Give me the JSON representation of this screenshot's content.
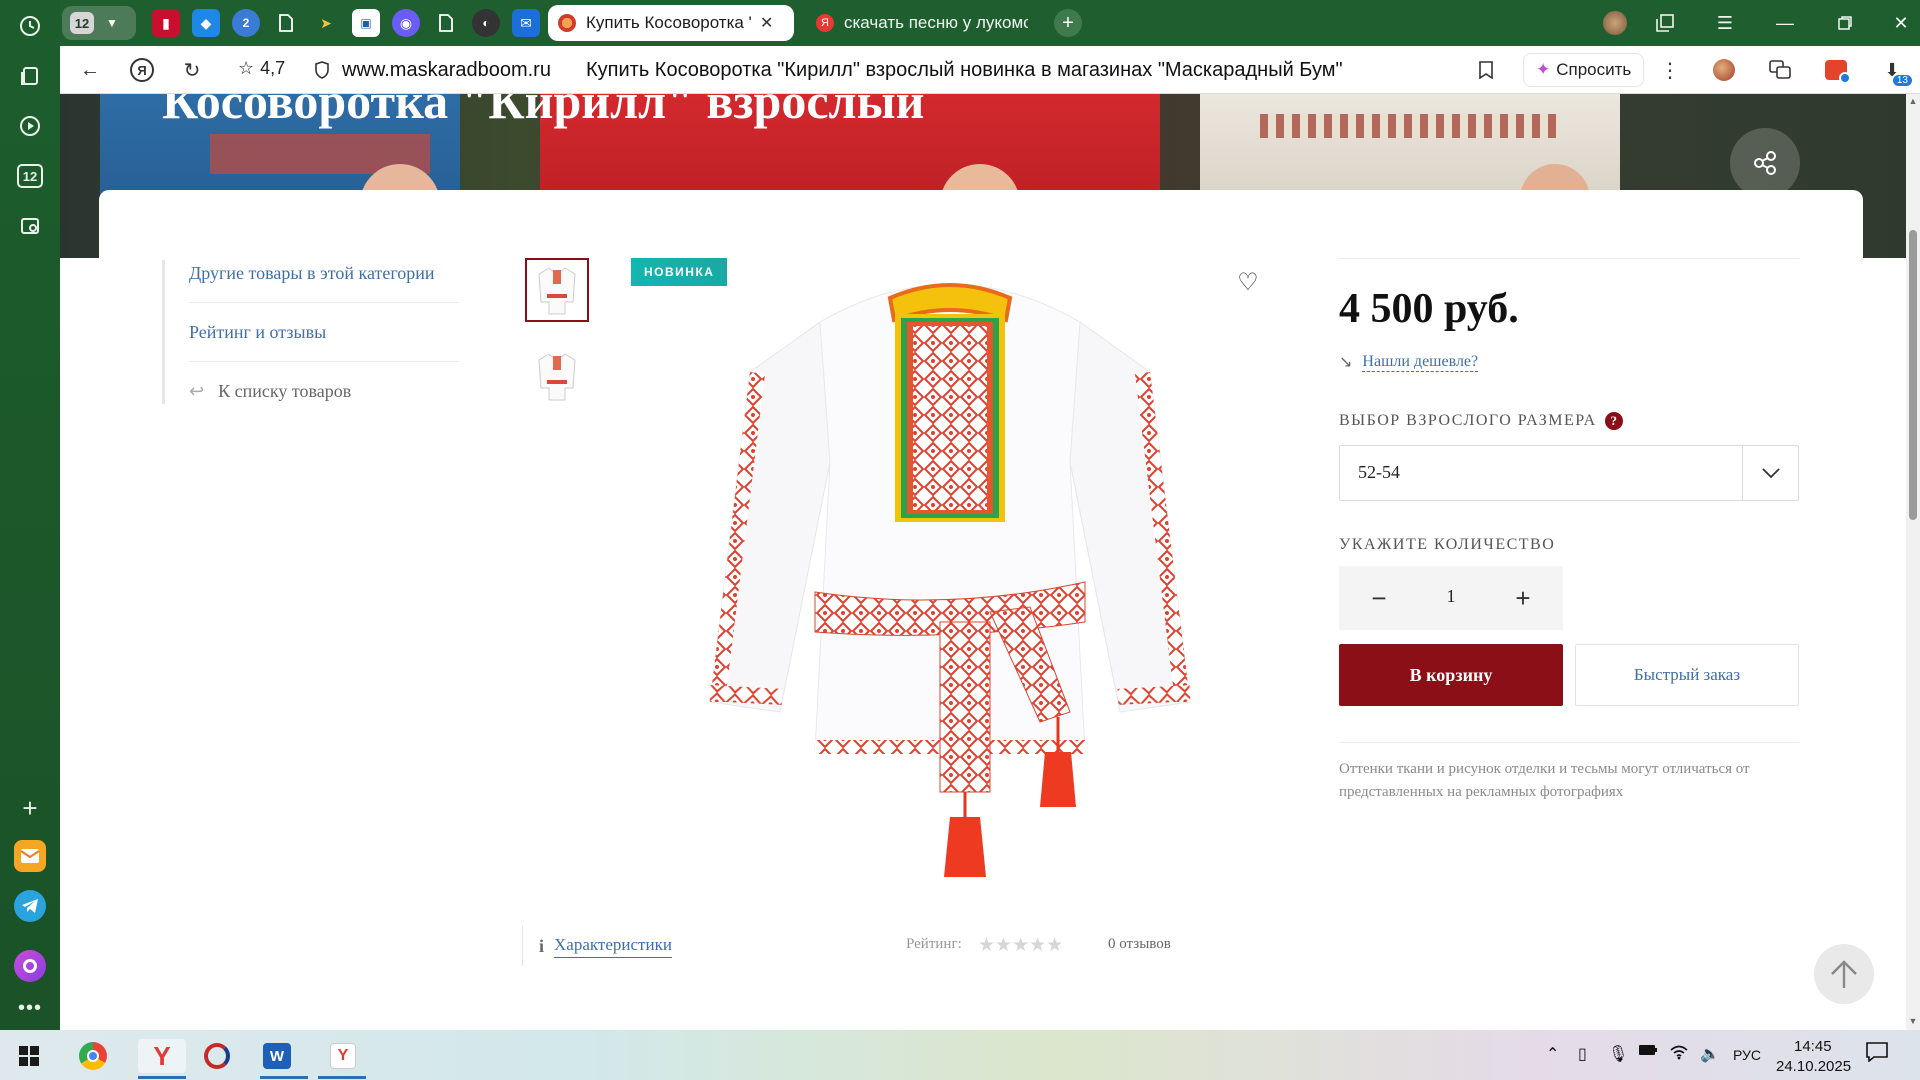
{
  "browser": {
    "tab_group_count": "12",
    "tabs": [
      {
        "title": "Купить Косоворотка \"Ки",
        "active": true
      },
      {
        "title": "скачать песню у лукомор",
        "active": false
      }
    ],
    "pinned_badges": {
      "counter": "2"
    },
    "address": {
      "rating": "4,7",
      "domain": "www.maskaradboom.ru",
      "page_title": "Купить Косоворотка \"Кирилл\" взрослый новинка в магазинах \"Маскарадный Бум\""
    },
    "ask_button": "Спросить",
    "extension_badge": "13",
    "sidebar_badge": "12"
  },
  "page": {
    "hero_title": "Косоворотка \"Кирилл\" взрослый",
    "left_nav": {
      "items": [
        "Другие товары в этой категории",
        "Рейтинг и отзывы"
      ],
      "back_link": "К списку товаров"
    },
    "badge_new": "НОВИНКА",
    "price": "4 500 руб.",
    "cheaper_link": "Нашли дешевле?",
    "size_label": "Выбор взрослого размера",
    "size_help": "?",
    "size_value": "52-54",
    "quantity_label": "Укажите количество",
    "quantity_value": "1",
    "add_to_cart": "В корзину",
    "quick_order": "Быстрый заказ",
    "disclaimer": "Оттенки ткани и рисунок отделки и тесьмы могут отличаться от представленных на рекламных фотографиях",
    "characteristics_tab": "Характеристики",
    "rating_label": "Рейтинг:",
    "rating_value": 0,
    "reviews_count": "0 отзывов"
  },
  "taskbar": {
    "language": "РУС",
    "time": "14:45",
    "date": "24.10.2025"
  },
  "colors": {
    "brand_red": "#8b0f16",
    "link_blue": "#3f6fa8",
    "badge_teal": "#13b6b0",
    "browser_green": "#1f5f2f"
  }
}
